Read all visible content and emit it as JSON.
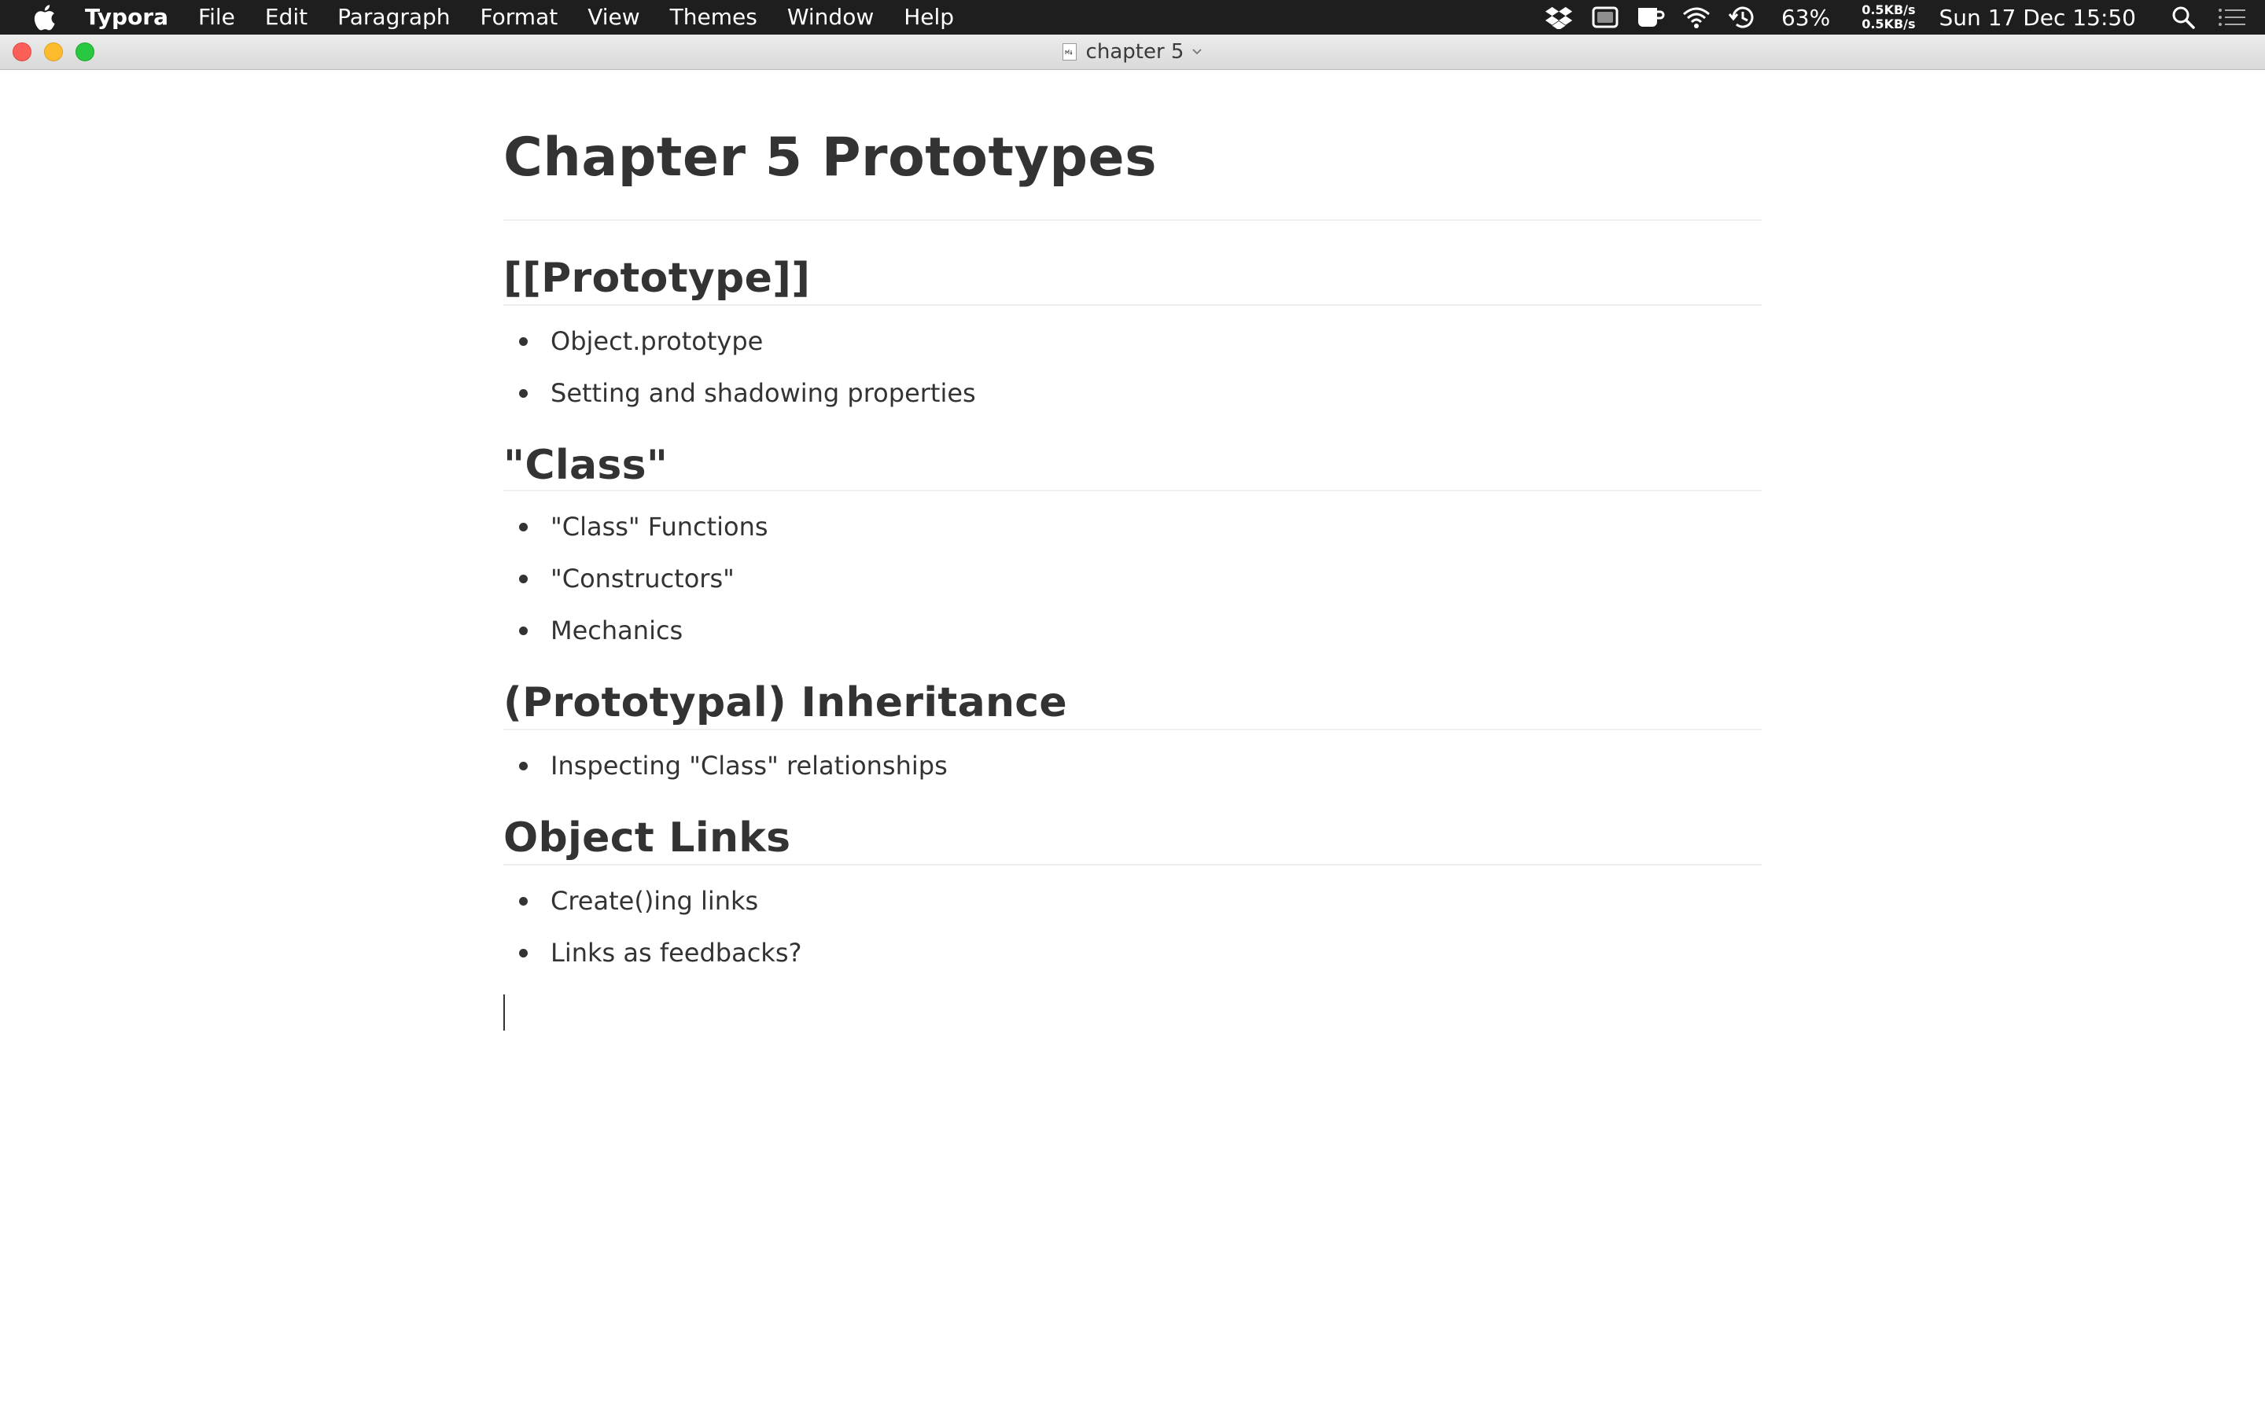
{
  "menubar": {
    "app_name": "Typora",
    "items": [
      "File",
      "Edit",
      "Paragraph",
      "Format",
      "View",
      "Themes",
      "Window",
      "Help"
    ],
    "battery": "63%",
    "net_up": "0.5KB/s",
    "net_down": "0.5KB/s",
    "clock": "Sun 17 Dec  15:50"
  },
  "window": {
    "title": "chapter 5"
  },
  "document": {
    "title": "Chapter 5 Prototypes",
    "sections": [
      {
        "heading": "[[Prototype]]",
        "items": [
          "Object.prototype",
          "Setting and shadowing properties"
        ]
      },
      {
        "heading": "\"Class\"",
        "items": [
          "\"Class\" Functions",
          "\"Constructors\"",
          "Mechanics"
        ]
      },
      {
        "heading": "(Prototypal) Inheritance",
        "items": [
          "Inspecting \"Class\" relationships"
        ]
      },
      {
        "heading": "Object Links",
        "items": [
          "Create()ing links",
          "Links as feedbacks?"
        ]
      }
    ]
  }
}
